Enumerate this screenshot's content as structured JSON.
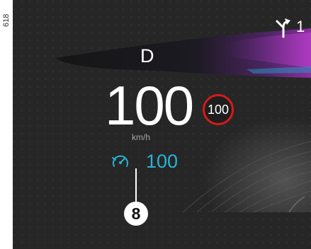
{
  "document": {
    "reference_code": "618"
  },
  "display": {
    "gear": "D",
    "speed": "100",
    "speed_unit": "km/h",
    "speed_limit": "100",
    "cruise_icon": "speedometer-icon",
    "cruise_set_speed": "100",
    "navigation": {
      "icon": "turn-right-arrow-icon",
      "value": "1"
    }
  },
  "callout": {
    "number": "8"
  },
  "colors": {
    "background": "#262626",
    "limit_ring": "#d71a1a",
    "cruise_accent": "#27b4d6",
    "text": "#ffffff",
    "unit_text": "#a8a8a8",
    "road_glow": "#8a2f9e"
  }
}
